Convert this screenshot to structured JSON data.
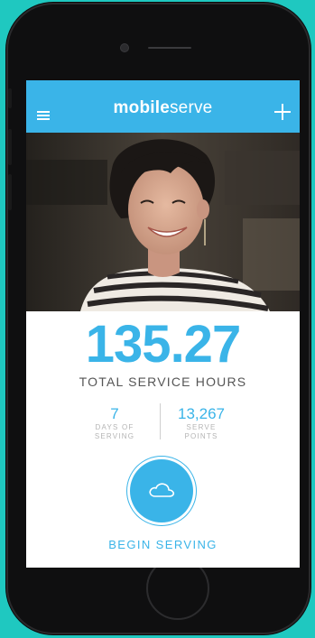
{
  "app": {
    "brand_part1": "mobile",
    "brand_part2": "serve"
  },
  "header": {
    "menu_icon": "hamburger-menu-icon",
    "add_icon": "plus-icon"
  },
  "hero": {
    "image": "smiling-woman-photo"
  },
  "stats": {
    "total_hours": "135.27",
    "total_label": "TOTAL SERVICE HOURS",
    "days_value": "7",
    "days_label_line1": "DAYS OF",
    "days_label_line2": "SERVING",
    "points_value": "13,267",
    "points_label_line1": "SERVE",
    "points_label_line2": "POINTS"
  },
  "action": {
    "icon": "cloud-icon",
    "label": "BEGIN SERVING"
  },
  "colors": {
    "background": "#1fc8c0",
    "accent": "#3ab4e8",
    "phone_body": "#0f0f10"
  }
}
